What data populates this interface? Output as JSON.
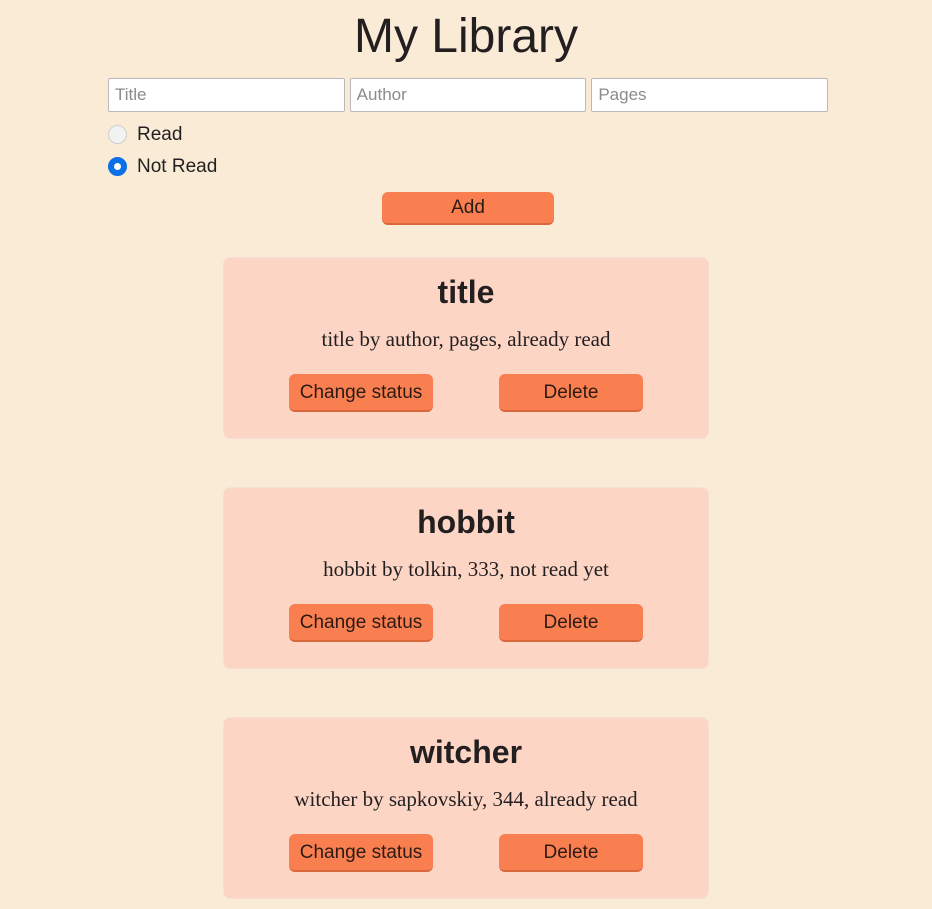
{
  "header": {
    "title": "My Library"
  },
  "form": {
    "fields": [
      {
        "name": "title",
        "placeholder": "Title",
        "value": ""
      },
      {
        "name": "author",
        "placeholder": "Author",
        "value": ""
      },
      {
        "name": "pages",
        "placeholder": "Pages",
        "value": ""
      }
    ],
    "radios": [
      {
        "label": "Read",
        "selected": false
      },
      {
        "label": "Not Read",
        "selected": true
      }
    ],
    "add_label": "Add"
  },
  "books": [
    {
      "title": "title",
      "description": "title by author, pages, already read",
      "change_status_label": "Change status",
      "delete_label": "Delete"
    },
    {
      "title": "hobbit",
      "description": "hobbit by tolkin, 333, not read yet",
      "change_status_label": "Change status",
      "delete_label": "Delete"
    },
    {
      "title": "witcher",
      "description": "witcher by sapkovskiy, 344, already read",
      "change_status_label": "Change status",
      "delete_label": "Delete"
    }
  ],
  "colors": {
    "page_background": "#faebd7",
    "card_background": "#fcd5c5",
    "button": "#f97f50",
    "button_shadow": "#d9683c",
    "radio_selected": "#0b6fe8",
    "text": "#231f20"
  }
}
